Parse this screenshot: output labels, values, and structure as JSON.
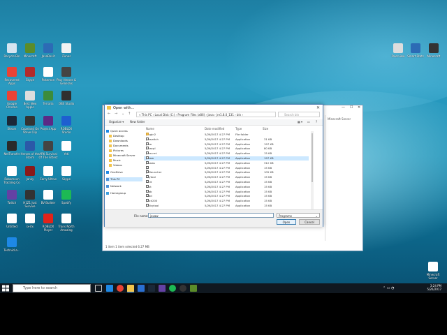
{
  "desktop": {
    "icons": [
      {
        "label": "Recycle Bin",
        "color": "#d6e4f0"
      },
      {
        "label": "Minecraft",
        "color": "#5b8c2a"
      },
      {
        "label": "JavaRevit",
        "color": "#2c6bb5"
      },
      {
        "label": "iTunes",
        "color": "#f2f2f2"
      },
      {
        "label": "Recovered Apps",
        "color": "#ea4335"
      },
      {
        "label": "Skype",
        "color": "#b22b2b"
      },
      {
        "label": "Pokemon",
        "color": "#ffffff"
      },
      {
        "label": "Play Heroes & Generals",
        "color": "#444444"
      },
      {
        "label": "Google Chrome",
        "color": "#ea4335"
      },
      {
        "label": "Best New Apple",
        "color": "#dddddd"
      },
      {
        "label": "Terraria",
        "color": "#3c8c3c"
      },
      {
        "label": "OBS Studio",
        "color": "#303030"
      },
      {
        "label": "Steam",
        "color": "#1b2838"
      },
      {
        "label": "Copeland On Steve Clip",
        "color": "#333333"
      },
      {
        "label": "Project App",
        "color": "#5b2a86"
      },
      {
        "label": "ROBLOX Studio",
        "color": "#1e5fd0"
      },
      {
        "label": "NetTransfer",
        "color": "#2a2a2a"
      },
      {
        "label": "Heroes of the Storm",
        "color": "#2b59a8"
      },
      {
        "label": "ARK Survival Of The Fittest",
        "color": "#444444"
      },
      {
        "label": "Yeti",
        "color": "#ffffff"
      },
      {
        "label": "Robomovn Tracking Co",
        "color": "#ffffff"
      },
      {
        "label": "Janky",
        "color": "#8a1a1a"
      },
      {
        "label": "Carry Ultrus",
        "color": "#ffffff"
      },
      {
        "label": "Skype",
        "color": "#ffffff"
      },
      {
        "label": "Twitch",
        "color": "#6441a4"
      },
      {
        "label": "H1Z1 Just Survive",
        "color": "#333333"
      },
      {
        "label": "BV Builder",
        "color": "#ffffff"
      },
      {
        "label": "Spotify",
        "color": "#1db954"
      },
      {
        "label": "Untitled",
        "color": "#ffffff"
      },
      {
        "label": "ix-itx",
        "color": "#ffffff"
      },
      {
        "label": "ROBLOX Player",
        "color": "#e2231a"
      },
      {
        "label": "Trans North Amazing",
        "color": "#ffffff"
      },
      {
        "label": "TechnicLa...",
        "color": "#1e88e5"
      }
    ],
    "right_icons": [
      {
        "label": "Overview",
        "color": "#dddddd"
      },
      {
        "label": "Smart Stats",
        "color": "#2c6bb5"
      },
      {
        "label": "Minecraft",
        "color": "#333333"
      }
    ],
    "server_icon": {
      "label": "Minecraft Server"
    }
  },
  "taskbar": {
    "search_placeholder": "Type here to search",
    "time": "3:24 PM",
    "date": "5/26/2017"
  },
  "explorer": {
    "pane_label": "Minecraft Server",
    "status": "1 item    1 item selected  6.27 MB"
  },
  "dialog": {
    "title": "Open with...",
    "address": "« This PC › Local Disk (C:) › Program Files (x86) › Java › jre1.8.0_131 › bin ›",
    "search_placeholder": "Search bin",
    "organize": "Organize ▾",
    "new_folder": "New folder",
    "columns": {
      "name": "Name",
      "date": "Date modified",
      "type": "Type",
      "size": "Size"
    },
    "nav": [
      {
        "label": "Quick access",
        "icon": "star"
      },
      {
        "label": "Desktop",
        "icon": "folder"
      },
      {
        "label": "Downloads",
        "icon": "folder"
      },
      {
        "label": "Documents",
        "icon": "folder"
      },
      {
        "label": "Pictures",
        "icon": "folder"
      },
      {
        "label": "Minecraft Server",
        "icon": "folder"
      },
      {
        "label": "Music",
        "icon": "folder"
      },
      {
        "label": "Videos",
        "icon": "folder"
      },
      {
        "label": "OneDrive",
        "icon": "cloud"
      },
      {
        "label": "This PC",
        "icon": "pc",
        "selected": true
      },
      {
        "label": "Network",
        "icon": "net"
      },
      {
        "label": "Homegroup",
        "icon": "home"
      }
    ],
    "files": [
      {
        "name": "plugin2",
        "date": "5/26/2017 4:27 PM",
        "type": "File folder",
        "size": "",
        "folder": true
      },
      {
        "name": "jabswitch",
        "date": "5/26/2017 4:27 PM",
        "type": "Application",
        "size": "31 KB"
      },
      {
        "name": "java",
        "date": "5/26/2017 4:27 PM",
        "type": "Application",
        "size": "197 KB"
      },
      {
        "name": "javacpl",
        "date": "5/26/2017 4:27 PM",
        "type": "Application",
        "size": "80 KB"
      },
      {
        "name": "java-rmi",
        "date": "5/26/2017 4:27 PM",
        "type": "Application",
        "size": "15 KB"
      },
      {
        "name": "javaw",
        "date": "5/26/2017 4:27 PM",
        "type": "Application",
        "size": "197 KB",
        "selected": true
      },
      {
        "name": "javaws",
        "date": "5/26/2017 4:27 PM",
        "type": "Application",
        "size": "312 KB"
      },
      {
        "name": "jjs",
        "date": "5/26/2017 4:27 PM",
        "type": "Application",
        "size": "15 KB"
      },
      {
        "name": "jp2launcher",
        "date": "5/26/2017 4:27 PM",
        "type": "Application",
        "size": "105 KB"
      },
      {
        "name": "keytool",
        "date": "5/26/2017 4:27 PM",
        "type": "Application",
        "size": "15 KB"
      },
      {
        "name": "kinit",
        "date": "5/26/2017 4:27 PM",
        "type": "Application",
        "size": "15 KB"
      },
      {
        "name": "klist",
        "date": "5/26/2017 4:27 PM",
        "type": "Application",
        "size": "15 KB"
      },
      {
        "name": "ktab",
        "date": "5/26/2017 4:27 PM",
        "type": "Application",
        "size": "15 KB"
      },
      {
        "name": "orbd",
        "date": "5/26/2017 4:27 PM",
        "type": "Application",
        "size": "15 KB"
      },
      {
        "name": "pack200",
        "date": "5/26/2017 4:27 PM",
        "type": "Application",
        "size": "15 KB"
      },
      {
        "name": "policytool",
        "date": "5/26/2017 4:27 PM",
        "type": "Application",
        "size": "15 KB"
      }
    ],
    "filename_label": "File name:",
    "filename_value": "javaw",
    "filetype_value": "Programs",
    "open_label": "Open",
    "cancel_label": "Cancel"
  }
}
